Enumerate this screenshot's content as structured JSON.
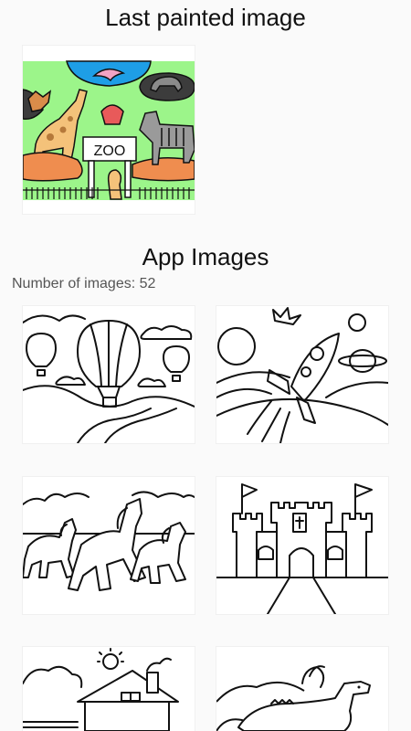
{
  "last_painted": {
    "title": "Last painted image",
    "image_sign": "ZOO"
  },
  "app_images": {
    "title": "App Images",
    "count_text": "Number of images: 52",
    "items": [
      {
        "icon": "hot-air-balloons-coloring-page"
      },
      {
        "icon": "space-rocket-coloring-page"
      },
      {
        "icon": "horses-coloring-page"
      },
      {
        "icon": "castle-coloring-page"
      },
      {
        "icon": "house-coloring-page"
      },
      {
        "icon": "dinosaur-coloring-page"
      }
    ]
  },
  "colors": {
    "background": "#fafafa",
    "grass": "#9cf58a",
    "water": "#1e9ee6",
    "sand": "#ef8d4f",
    "elephant_area": "#3c3c3c"
  }
}
